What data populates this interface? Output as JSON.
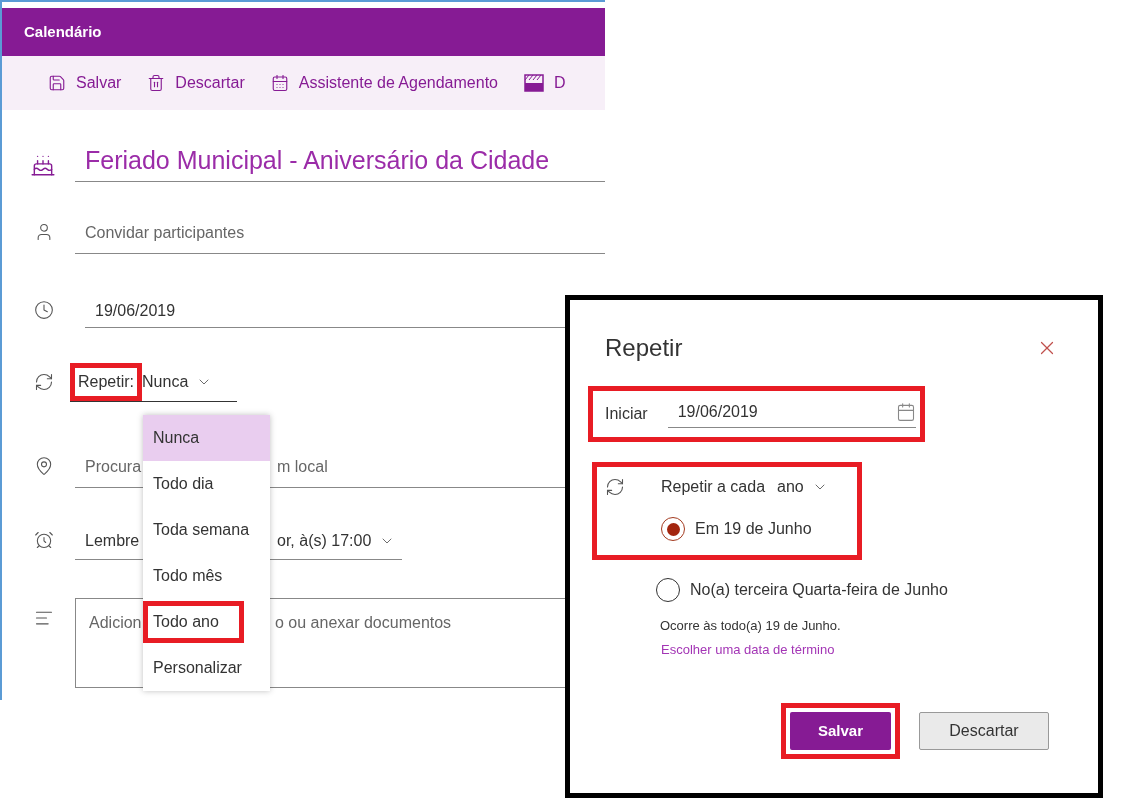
{
  "app_title": "Calendário",
  "toolbar": [
    {
      "kind": "save",
      "label": "Salvar"
    },
    {
      "kind": "discard",
      "label": "Descartar"
    },
    {
      "kind": "scheduler",
      "label": "Assistente de Agendamento"
    },
    {
      "kind": "category",
      "label": "D"
    }
  ],
  "event_title": "Feriado Municipal - Aniversário da Cidade",
  "attendees": {
    "placeholder": "Convidar participantes"
  },
  "date": {
    "value": "19/06/2019"
  },
  "repeat": {
    "label": "Repetir:",
    "value": "Nunca",
    "highlighted": true
  },
  "location": {
    "visible_start": "Procura",
    "visible_end": "m local"
  },
  "reminder": {
    "visible_start": "Lembre",
    "visible_end": "or, à(s) 17:00"
  },
  "notes": {
    "visible_start": "Adicion",
    "visible_end": "o ou anexar documentos"
  },
  "repeat_menu": [
    {
      "label": "Nunca",
      "selected": true,
      "highlighted": false
    },
    {
      "label": "Todo dia",
      "selected": false,
      "highlighted": false
    },
    {
      "label": "Toda semana",
      "selected": false,
      "highlighted": false
    },
    {
      "label": "Todo mês",
      "selected": false,
      "highlighted": false
    },
    {
      "label": "Todo ano",
      "selected": false,
      "highlighted": true
    },
    {
      "label": "Personalizar",
      "selected": false,
      "highlighted": false
    }
  ],
  "dialog": {
    "title": "Repetir",
    "start": {
      "label": "Iniciar",
      "value": "19/06/2019",
      "highlighted": true
    },
    "repeat_every": {
      "label": "Repetir a cada",
      "unit": "ano",
      "highlighted": true
    },
    "options": [
      {
        "label": "Em 19 de Junho",
        "selected": true
      },
      {
        "label": "No(a) terceira Quarta-feira de Junho",
        "selected": false
      }
    ],
    "summary": "Ocorre às todo(a) 19 de Junho.",
    "end_date_link": "Escolher uma data de término",
    "buttons": [
      {
        "kind": "primary",
        "label": "Salvar",
        "highlighted": true
      },
      {
        "kind": "secondary",
        "label": "Descartar",
        "highlighted": false
      }
    ]
  }
}
